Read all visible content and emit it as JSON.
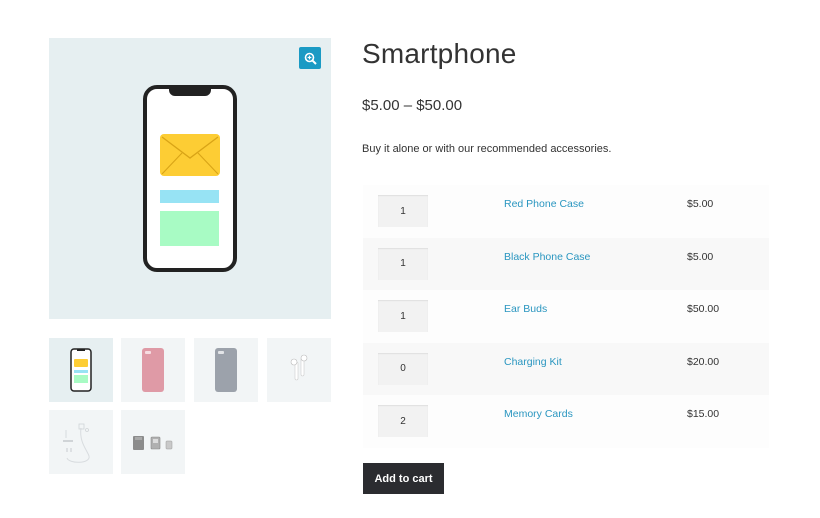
{
  "product": {
    "title": "Smartphone",
    "price_range": "$5.00 – $50.00",
    "description": "Buy it alone or with our recommended accessories."
  },
  "gallery": {
    "zoom_icon": "magnifier-plus-icon",
    "main_image": "smartphone-with-envelope",
    "thumbnails": [
      {
        "label": "Smartphone",
        "active": true
      },
      {
        "label": "Red Phone Case",
        "active": false
      },
      {
        "label": "Black Phone Case",
        "active": false
      },
      {
        "label": "Ear Buds",
        "active": false
      },
      {
        "label": "Charging Kit",
        "active": false
      },
      {
        "label": "Memory Cards",
        "active": false
      }
    ]
  },
  "grouped_items": [
    {
      "qty": "1",
      "name": "Red Phone Case",
      "price": "$5.00"
    },
    {
      "qty": "1",
      "name": "Black Phone Case",
      "price": "$5.00"
    },
    {
      "qty": "1",
      "name": "Ear Buds",
      "price": "$50.00"
    },
    {
      "qty": "0",
      "name": "Charging Kit",
      "price": "$20.00"
    },
    {
      "qty": "2",
      "name": "Memory Cards",
      "price": "$15.00"
    }
  ],
  "actions": {
    "add_to_cart": "Add to cart"
  },
  "colors": {
    "accent_link": "#2a96c0",
    "zoom_button": "#1b9ac4",
    "button_dark": "#2b2c30",
    "envelope": "#fdcd34"
  }
}
